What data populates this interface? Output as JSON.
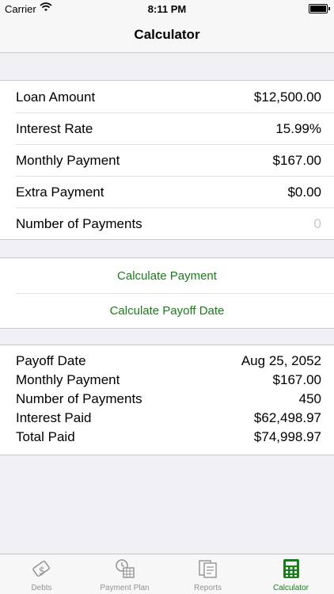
{
  "status": {
    "carrier": "Carrier",
    "time": "8:11 PM"
  },
  "nav": {
    "title": "Calculator"
  },
  "inputs": [
    {
      "label": "Loan Amount",
      "value": "$12,500.00"
    },
    {
      "label": "Interest Rate",
      "value": "15.99%"
    },
    {
      "label": "Monthly Payment",
      "value": "$167.00"
    },
    {
      "label": "Extra Payment",
      "value": "$0.00"
    },
    {
      "label": "Number of Payments",
      "placeholder": "0"
    }
  ],
  "actions": {
    "calc_payment": "Calculate Payment",
    "calc_payoff": "Calculate Payoff Date"
  },
  "results": [
    {
      "label": "Payoff Date",
      "value": "Aug 25, 2052"
    },
    {
      "label": "Monthly Payment",
      "value": "$167.00"
    },
    {
      "label": "Number of Payments",
      "value": "450"
    },
    {
      "label": "Interest Paid",
      "value": "$62,498.97"
    },
    {
      "label": "Total Paid",
      "value": "$74,998.97"
    }
  ],
  "tabs": [
    {
      "label": "Debts",
      "icon": "debts-icon"
    },
    {
      "label": "Payment Plan",
      "icon": "payment-plan-icon"
    },
    {
      "label": "Reports",
      "icon": "reports-icon"
    },
    {
      "label": "Calculator",
      "icon": "calculator-icon",
      "active": true
    }
  ],
  "colors": {
    "accent": "#1a7d1a",
    "background": "#efeff4",
    "inactive_tab": "#929292"
  }
}
